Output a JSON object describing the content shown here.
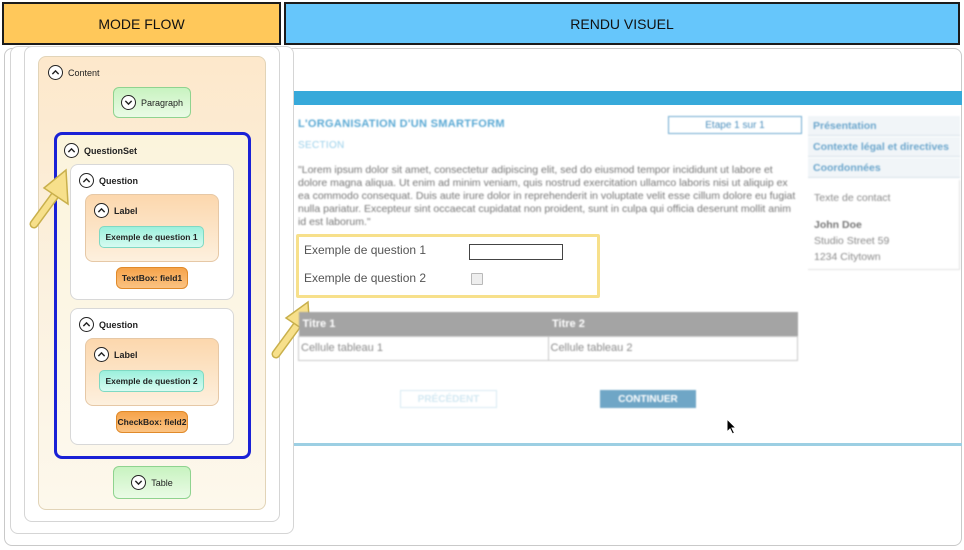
{
  "headers": {
    "left": "MODE FLOW",
    "right": "RENDU VISUEL"
  },
  "flow": {
    "content_label": "Content",
    "paragraph_label": "Paragraph",
    "questionset_label": "QuestionSet",
    "questions": [
      {
        "title": "Question",
        "label_title": "Label",
        "label_text": "Exemple de question 1",
        "field": "TextBox: field1"
      },
      {
        "title": "Question",
        "label_title": "Label",
        "label_text": "Exemple de question 2",
        "field": "CheckBox: field2"
      }
    ],
    "table_label": "Table"
  },
  "render": {
    "form_title": "L'ORGANISATION D'UN SMARTFORM",
    "section": "SECTION",
    "step": "Etape 1 sur 1",
    "lorem": "\"Lorem ipsum dolor sit amet, consectetur adipiscing elit, sed do eiusmod tempor incididunt ut labore et dolore magna aliqua. Ut enim ad minim veniam, quis nostrud exercitation ullamco laboris nisi ut aliquip ex ea commodo consequat. Duis aute irure dolor in reprehenderit in voluptate velit esse cillum dolore eu fugiat nulla pariatur. Excepteur sint occaecat cupidatat non proident, sunt in culpa qui officia deserunt mollit anim id est laborum.\"",
    "question1": "Exemple de question 1",
    "question2": "Exemple de question 2",
    "table": {
      "headers": [
        "Titre 1",
        "Titre 2"
      ],
      "rows": [
        [
          "Cellule tableau 1",
          "Cellule tableau 2"
        ]
      ]
    },
    "prev_button": "PRÉCÉDENT",
    "next_button": "CONTINUER",
    "sidebar_items": [
      "Présentation",
      "Contexte légal et directives",
      "Coordonnées"
    ],
    "contact": {
      "title": "Texte de contact",
      "name": "John Doe",
      "street": "Studio Street 59",
      "city": "1234 Citytown"
    }
  },
  "colors": {
    "flow_header": "#ffc85a",
    "render_header": "#66c6fb",
    "questionset_border": "#1a21d6",
    "accent_blue": "#37a9da",
    "arrow_yellow": "#f7e08b"
  }
}
